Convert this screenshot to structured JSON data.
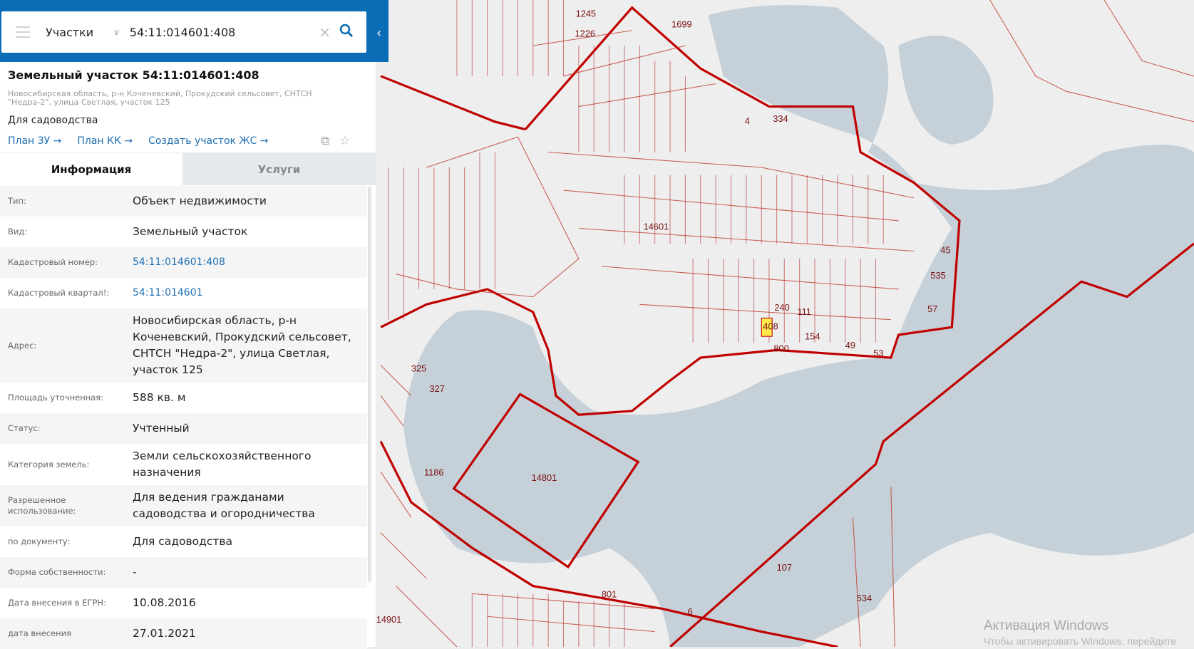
{
  "search": {
    "layer": "Участки",
    "query": "54:11:014601:408"
  },
  "card": {
    "title": "Земельный участок 54:11:014601:408",
    "address": "Новосибирская область, р-н Коченевский, Прокудский сельсовет, СНТСН \"Недра-2\", улица Светлая, участок 125",
    "purpose": "Для садоводства",
    "links": [
      "План ЗУ →",
      "План КК →",
      "Создать участок ЖС →"
    ]
  },
  "tabs": [
    "Информация",
    "Услуги"
  ],
  "rows": [
    {
      "label": "Тип:",
      "value": "Объект недвижимости"
    },
    {
      "label": "Вид:",
      "value": "Земельный участок"
    },
    {
      "label": "Кадастровый номер:",
      "value": "54:11:014601:408"
    },
    {
      "label": "Кадастровый квартал!:",
      "value": "54:11:014601"
    },
    {
      "label": "Адрес:",
      "value": "Новосибирская область, р-н Коченевский, Прокудский сельсовет, СНТСН \"Недра-2\", улица Светлая, участок 125"
    },
    {
      "label": "Площадь уточненная:",
      "value": "588 кв. м"
    },
    {
      "label": "Статус:",
      "value": "Учтенный"
    },
    {
      "label": "Категория земель:",
      "value": "Земли сельскохозяйственного назначения"
    },
    {
      "label": "Разрешенное использование:",
      "value": "Для ведения гражданами садоводства и огородничества"
    },
    {
      "label": "по документу:",
      "value": "Для садоводства"
    },
    {
      "label": "Форма собственности:",
      "value": "-"
    },
    {
      "label": "Дата внесения в ЕГРН:",
      "value": "10.08.2016"
    },
    {
      "label": "дата внесения",
      "value": "27.01.2021"
    }
  ],
  "map": {
    "labels": [
      "14601",
      "14801",
      "1186",
      "1699",
      "107",
      "801",
      "534",
      "14901",
      "408",
      "6",
      "535",
      "45",
      "57",
      "325",
      "327",
      "1245",
      "1226",
      "4",
      "334",
      "240",
      "800",
      "154",
      "49",
      "53",
      "111"
    ],
    "colors": {
      "water": "#c5d0d8",
      "land": "#ececec",
      "boundary": "#c00000",
      "selected": "#ffe94d"
    }
  },
  "watermark": {
    "title": "Активация Windows",
    "sub": "Чтобы активировать Windows, перейдите"
  }
}
